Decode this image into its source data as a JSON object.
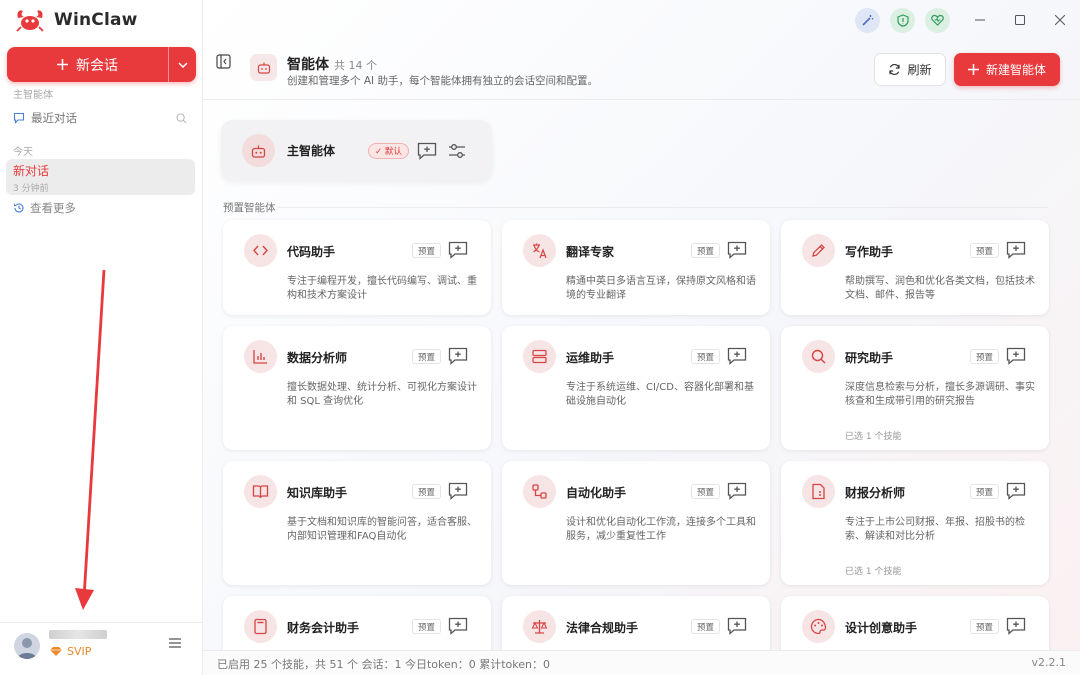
{
  "app": {
    "name": "WinClaw"
  },
  "sidebar": {
    "new_chat_label": "新会话",
    "section_main": "主智能体",
    "recent_label": "最近对话",
    "today_label": "今天",
    "chat": {
      "title": "新对话",
      "time": "3 分钟前"
    },
    "more_label": "查看更多",
    "user": {
      "badge": "SVIP"
    }
  },
  "header": {
    "title": "智能体",
    "count": "共 14 个",
    "description": "创建和管理多个 AI 助手，每个智能体拥有独立的会话空间和配置。",
    "refresh_label": "刷新",
    "new_agent_label": "新建智能体"
  },
  "main_agent": {
    "name": "主智能体",
    "badge": "✓ 默认"
  },
  "preset_section_label": "预置智能体",
  "preset_tag": "预置",
  "agents": [
    {
      "name": "代码助手",
      "icon": "code-icon",
      "desc": "专注于编程开发，擅长代码编写、调试、重构和技术方案设计",
      "skills": ""
    },
    {
      "name": "翻译专家",
      "icon": "translate-icon",
      "desc": "精通中英日多语言互译，保持原文风格和语境的专业翻译",
      "skills": ""
    },
    {
      "name": "写作助手",
      "icon": "pencil-icon",
      "desc": "帮助撰写、润色和优化各类文档，包括技术文档、邮件、报告等",
      "skills": ""
    },
    {
      "name": "数据分析师",
      "icon": "bar-chart-icon",
      "desc": "擅长数据处理、统计分析、可视化方案设计和 SQL 查询优化",
      "skills": ""
    },
    {
      "name": "运维助手",
      "icon": "server-icon",
      "desc": "专注于系统运维、CI/CD、容器化部署和基础设施自动化",
      "skills": ""
    },
    {
      "name": "研究助手",
      "icon": "search-icon",
      "desc": "深度信息检索与分析，擅长多源调研、事实核查和生成带引用的研究报告",
      "skills": "已选 1 个技能"
    },
    {
      "name": "知识库助手",
      "icon": "book-icon",
      "desc": "基于文档和知识库的智能问答，适合客服、内部知识管理和FAQ自动化",
      "skills": ""
    },
    {
      "name": "自动化助手",
      "icon": "workflow-icon",
      "desc": "设计和优化自动化工作流，连接多个工具和服务，减少重复性工作",
      "skills": ""
    },
    {
      "name": "财报分析师",
      "icon": "report-icon",
      "desc": "专注于上市公司财报、年报、招股书的检索、解读和对比分析",
      "skills": "已选 1 个技能"
    },
    {
      "name": "财务会计助手",
      "icon": "calculator-icon",
      "desc": "",
      "skills": ""
    },
    {
      "name": "法律合规助手",
      "icon": "scale-icon",
      "desc": "",
      "skills": ""
    },
    {
      "name": "设计创意助手",
      "icon": "palette-icon",
      "desc": "",
      "skills": ""
    }
  ],
  "status": {
    "text": "已启用 25 个技能，共 51 个  会话：1  今日token：0  累计token：0",
    "version": "v2.2.1"
  },
  "colors": {
    "accent": "#e8393c",
    "badge_orange": "#ea8a2a"
  }
}
